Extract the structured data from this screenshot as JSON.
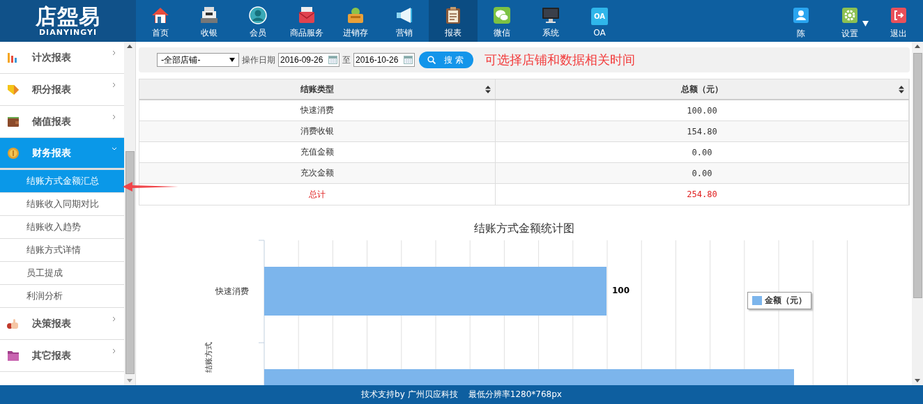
{
  "header": {
    "logo": {
      "title": "店盌易",
      "subtitle": "DIANYINGYI"
    },
    "nav": [
      {
        "label": "首页",
        "selected": false
      },
      {
        "label": "收银",
        "selected": false
      },
      {
        "label": "会员",
        "selected": false
      },
      {
        "label": "商品服务",
        "selected": false
      },
      {
        "label": "进销存",
        "selected": false
      },
      {
        "label": "营销",
        "selected": false
      },
      {
        "label": "报表",
        "selected": true
      },
      {
        "label": "微信",
        "selected": false
      },
      {
        "label": "系统",
        "selected": false
      },
      {
        "label": "OA",
        "icon_text": "OA",
        "selected": false
      }
    ],
    "user_menu": [
      {
        "label": "陈",
        "dropdown": false
      },
      {
        "label": "设置",
        "dropdown": true
      },
      {
        "label": "退出",
        "dropdown": false
      }
    ]
  },
  "sidebar": {
    "groups": [
      {
        "label": "计次报表",
        "expanded": false
      },
      {
        "label": "积分报表",
        "expanded": false
      },
      {
        "label": "储值报表",
        "expanded": false
      },
      {
        "label": "财务报表",
        "expanded": true,
        "children": [
          {
            "label": "结账方式金额汇总",
            "selected": true
          },
          {
            "label": "结账收入同期对比",
            "selected": false
          },
          {
            "label": "结账收入趋势",
            "selected": false
          },
          {
            "label": "结账方式详情",
            "selected": false
          },
          {
            "label": "员工提成",
            "selected": false
          },
          {
            "label": "利润分析",
            "selected": false
          }
        ]
      },
      {
        "label": "决策报表",
        "expanded": false
      },
      {
        "label": "其它报表",
        "expanded": false
      }
    ]
  },
  "filter": {
    "store": "-全部店铺-",
    "date_label": "操作日期",
    "start_date": "2016-09-26",
    "separator": "至",
    "end_date": "2016-10-26",
    "search_button": "搜 索",
    "annotation": "可选择店铺和数据相关时间"
  },
  "table": {
    "columns": [
      "结账类型",
      "总额（元）"
    ],
    "rows": [
      {
        "cells": [
          "快速消费",
          "100.00"
        ],
        "kind": "normal"
      },
      {
        "cells": [
          "消费收银",
          "154.80"
        ],
        "kind": "normal"
      },
      {
        "cells": [
          "充值金额",
          "0.00"
        ],
        "kind": "normal"
      },
      {
        "cells": [
          "充次金额",
          "0.00"
        ],
        "kind": "normal"
      },
      {
        "cells": [
          "总计",
          "254.80"
        ],
        "kind": "total"
      }
    ]
  },
  "chart": {
    "title": "结账方式金额统计图",
    "axis_title": "结账方式",
    "category_labels": [
      "快速消费"
    ],
    "value_labels": [
      "100"
    ],
    "legend": "金额（元）"
  },
  "footer": {
    "text": "技术支持by 广州贝应科技    最低分辨率1280*768px"
  }
}
